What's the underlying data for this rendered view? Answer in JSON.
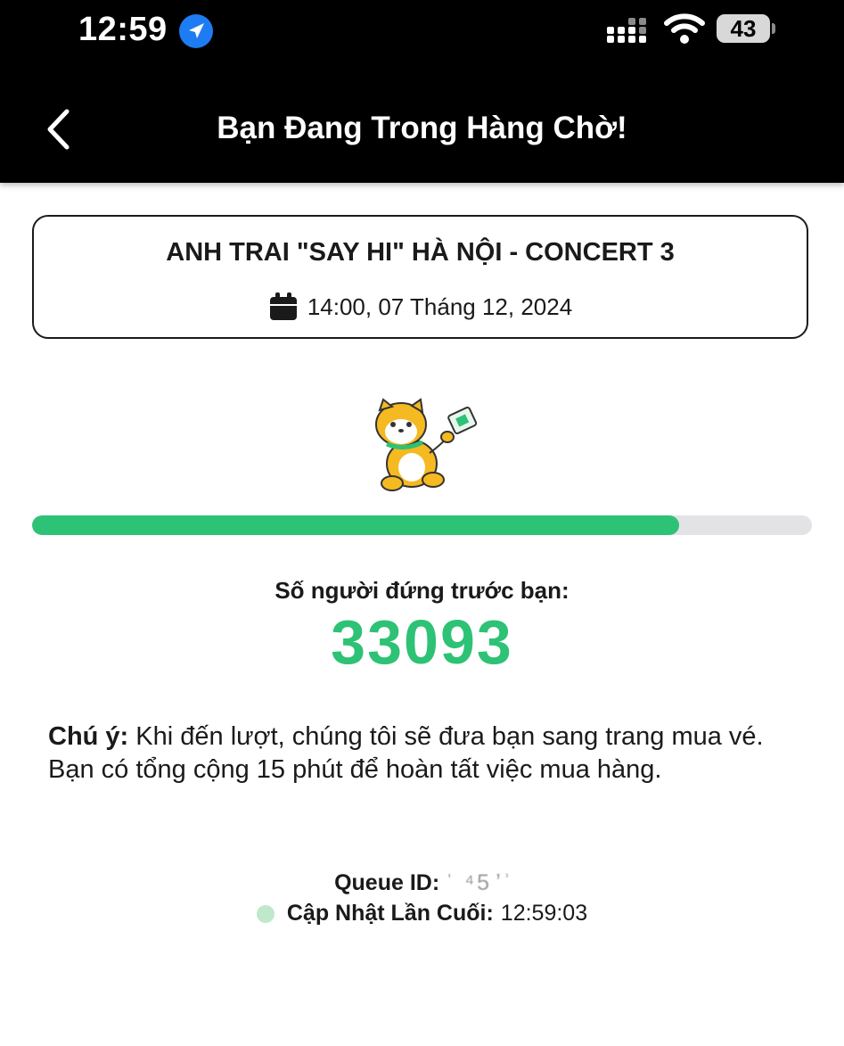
{
  "status_bar": {
    "time": "12:59",
    "battery": "43",
    "icons": [
      "location-arrow-icon",
      "signal-icon",
      "wifi-icon",
      "battery-icon"
    ]
  },
  "header": {
    "title": "Bạn Đang Trong Hàng Chờ!",
    "back_icon": "chevron-left-icon"
  },
  "event": {
    "title": "ANH TRAI \"SAY HI\" HÀ NỘI - CONCERT 3",
    "date": "14:00, 07 Tháng 12, 2024",
    "date_icon": "calendar-icon"
  },
  "queue": {
    "progress": 0.83,
    "ahead_label": "Số người đứng trước bạn:",
    "ahead_count": "33093",
    "note_label": "Chú ý:",
    "note_text": " Khi đến lượt, chúng tôi sẽ đưa bạn sang trang mua vé. Bạn có tổng cộng 15 phút để hoàn tất việc mua hàng.",
    "queue_id_label": "Queue ID:",
    "queue_id_value": "ˈ ⁴5  ̓  ͗",
    "last_updated_label": "Cập Nhật Lần Cuối:",
    "last_updated_value": "12:59:03"
  },
  "colors": {
    "accent_green": "#2dc275",
    "track_gray": "#e3e3e6",
    "header_bg": "#000000",
    "status_dot": "#bfe8cc"
  }
}
